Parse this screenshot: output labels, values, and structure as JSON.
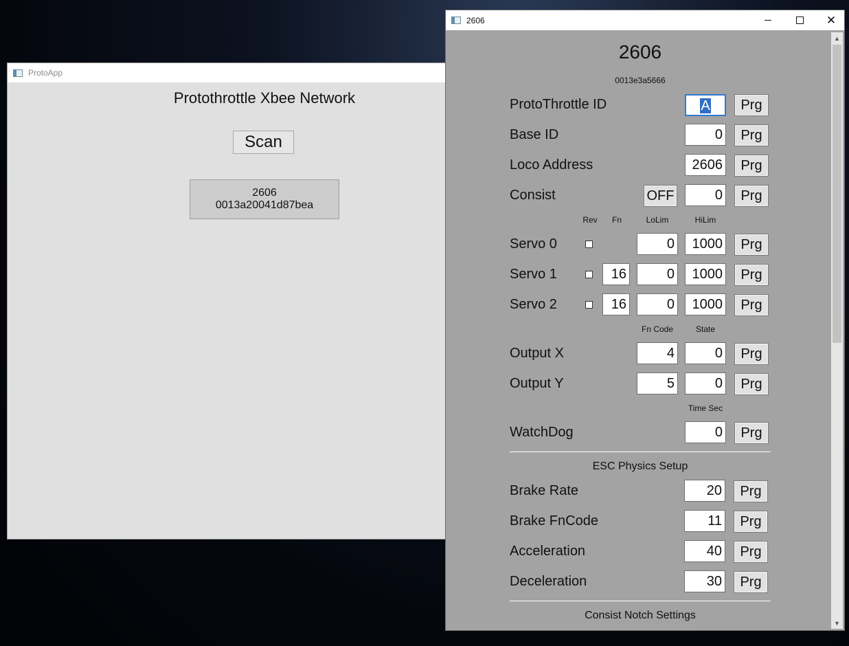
{
  "protoapp": {
    "title": "ProtoApp",
    "heading": "Protothrottle Xbee Network",
    "scan_label": "Scan",
    "device": {
      "name": "2606",
      "address": "0013a20041d87bea"
    }
  },
  "config": {
    "window_title": "2606",
    "heading": "2606",
    "address": "0013e3a5666",
    "rows": {
      "pt_id": {
        "label": "ProtoThrottle ID",
        "value": "A"
      },
      "base_id": {
        "label": "Base ID",
        "value": "0"
      },
      "loco": {
        "label": "Loco Address",
        "value": "2606"
      },
      "consist": {
        "label": "Consist",
        "toggle": "OFF",
        "value": "0"
      }
    },
    "servo_headers": {
      "rev": "Rev",
      "fn": "Fn",
      "lolim": "LoLim",
      "hilim": "HiLim"
    },
    "servos": [
      {
        "label": "Servo 0",
        "fn": "",
        "lolim": "0",
        "hilim": "1000"
      },
      {
        "label": "Servo 1",
        "fn": "16",
        "lolim": "0",
        "hilim": "1000"
      },
      {
        "label": "Servo 2",
        "fn": "16",
        "lolim": "0",
        "hilim": "1000"
      }
    ],
    "output_headers": {
      "fncode": "Fn Code",
      "state": "State"
    },
    "outputs": [
      {
        "label": "Output X",
        "fncode": "4",
        "state": "0"
      },
      {
        "label": "Output Y",
        "fncode": "5",
        "state": "0"
      }
    ],
    "watchdog": {
      "header": "Time Sec",
      "label": "WatchDog",
      "value": "0"
    },
    "esc_title": "ESC Physics Setup",
    "esc": [
      {
        "label": "Brake Rate",
        "value": "20"
      },
      {
        "label": "Brake FnCode",
        "value": "11"
      },
      {
        "label": "Acceleration",
        "value": "40"
      },
      {
        "label": "Deceleration",
        "value": "30"
      }
    ],
    "consist_notch_title": "Consist Notch Settings",
    "prg_label": "Prg"
  }
}
